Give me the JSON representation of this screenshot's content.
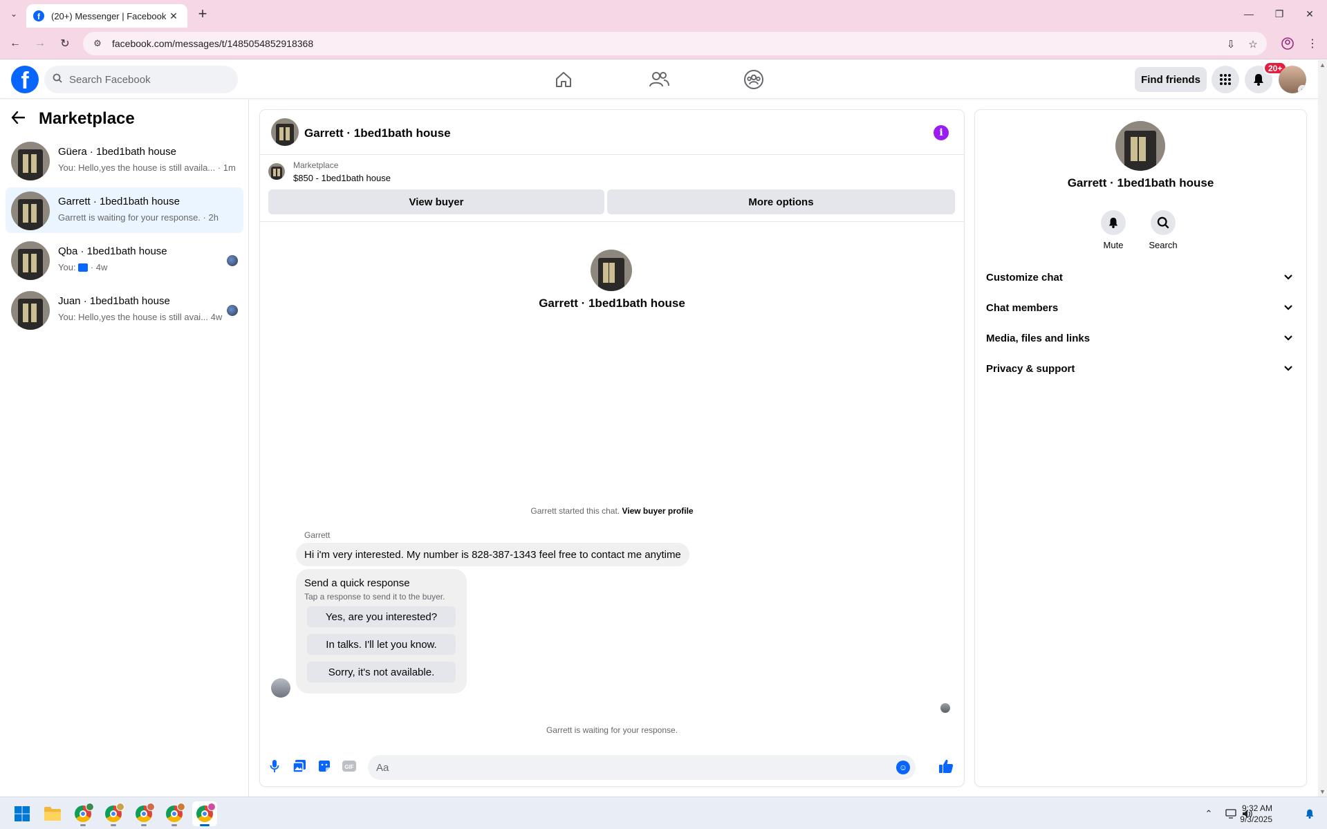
{
  "browser": {
    "tab_title": "(20+) Messenger | Facebook",
    "url": "facebook.com/messages/t/1485054852918368"
  },
  "header": {
    "search_placeholder": "Search Facebook",
    "find_friends": "Find friends",
    "notification_count": "20+",
    "brand_color": "#0866ff"
  },
  "sidebar": {
    "title": "Marketplace",
    "chats": [
      {
        "name": "Güera · 1bed1bath house",
        "preview": "You: Hello,yes the house is still availa...",
        "time": "1m"
      },
      {
        "name": "Garrett · 1bed1bath house",
        "preview": "Garrett is waiting for your response.",
        "time": "2h"
      },
      {
        "name": "Qba · 1bed1bath house",
        "preview": "You:",
        "time": "4w"
      },
      {
        "name": "Juan · 1bed1bath house",
        "preview": "You: Hello,yes the house is still avai...",
        "time": "4w"
      }
    ]
  },
  "chat": {
    "title": "Garrett · 1bed1bath house",
    "marketplace_label": "Marketplace",
    "listing": "$850 - 1bed1bath house",
    "view_buyer": "View buyer",
    "more_options": "More options",
    "intro_name": "Garrett · 1bed1bath house",
    "started_text": "Garrett started this chat.",
    "view_buyer_profile": "View buyer profile",
    "sender": "Garrett",
    "message": "Hi i'm very interested. My number is 828-387-1343 feel free to contact me anytime",
    "quick_response": {
      "heading": "Send a quick response",
      "subtitle": "Tap a response to send it to the buyer.",
      "options": [
        "Yes, are you interested?",
        "In talks. I'll let you know.",
        "Sorry, it's not available."
      ]
    },
    "waiting_text": "Garrett is waiting for your response.",
    "composer_placeholder": "Aa"
  },
  "info_panel": {
    "name": "Garrett · 1bed1bath house",
    "mute": "Mute",
    "search": "Search",
    "sections": [
      "Customize chat",
      "Chat members",
      "Media, files and links",
      "Privacy & support"
    ]
  },
  "taskbar": {
    "time": "9:32 AM",
    "date": "9/3/2025"
  }
}
